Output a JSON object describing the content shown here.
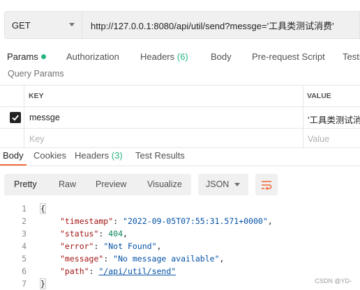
{
  "request": {
    "method": "GET",
    "url": "http://127.0.0.1:8080/api/util/send?messge='工具类测试消费'"
  },
  "request_tabs": [
    {
      "label": "Params"
    },
    {
      "label": "Authorization"
    },
    {
      "label": "Headers",
      "count": "(6)"
    },
    {
      "label": "Body"
    },
    {
      "label": "Pre-request Script"
    },
    {
      "label": "Tests"
    }
  ],
  "params": {
    "title": "Query Params",
    "columns": {
      "key": "KEY",
      "value": "VALUE"
    },
    "rows": [
      {
        "key": "messge",
        "value": "'工具类测试消",
        "checked": true
      }
    ],
    "new_row": {
      "key_placeholder": "Key",
      "value_placeholder": "Value"
    }
  },
  "response_tabs": [
    {
      "label": "Body"
    },
    {
      "label": "Cookies"
    },
    {
      "label": "Headers",
      "count": "(3)"
    },
    {
      "label": "Test Results"
    }
  ],
  "view_modes": [
    "Pretty",
    "Raw",
    "Preview",
    "Visualize"
  ],
  "format": "JSON",
  "code": {
    "open": "{",
    "close": "}",
    "lines": [
      {
        "key": "\"timestamp\"",
        "value": "\"2022-09-05T07:55:31.571+0000\"",
        "type": "str"
      },
      {
        "key": "\"status\"",
        "value": "404",
        "type": "num"
      },
      {
        "key": "\"error\"",
        "value": "\"Not Found\"",
        "type": "str"
      },
      {
        "key": "\"message\"",
        "value": "\"No message available\"",
        "type": "str"
      },
      {
        "key": "\"path\"",
        "value": "\"/api/util/send\"",
        "type": "str"
      }
    ],
    "line_numbers": [
      "1",
      "2",
      "3",
      "4",
      "5",
      "6",
      "7"
    ]
  },
  "watermark": "CSDN @YD-",
  "colors": {
    "accent": "#f26b3a",
    "success": "#26b47f"
  }
}
